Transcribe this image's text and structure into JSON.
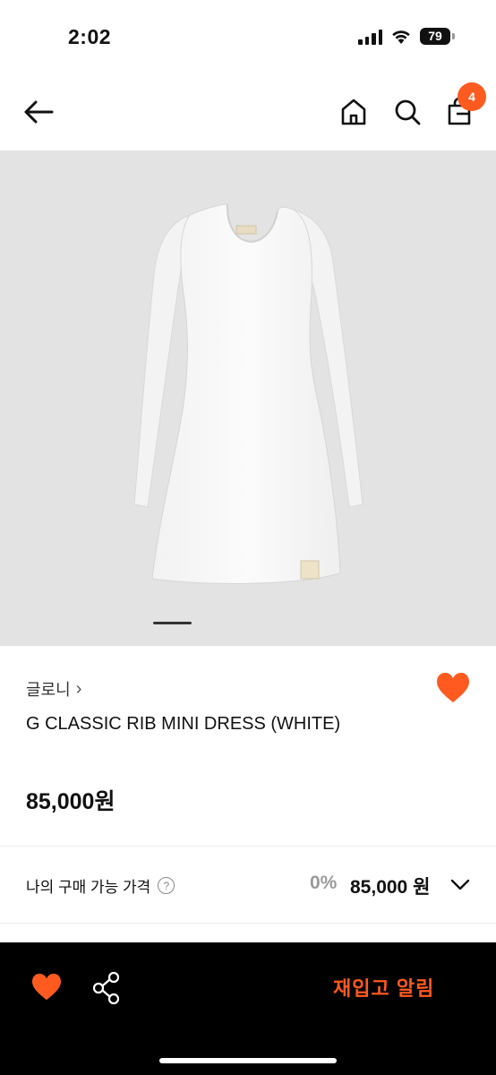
{
  "status_bar": {
    "time": "2:02",
    "battery": "79"
  },
  "header": {
    "cart_count": "4"
  },
  "product": {
    "brand": "글로니",
    "brand_arrow": "›",
    "name": "G CLASSIC RIB MINI DRESS (WHITE)",
    "price": "85,000원",
    "liked": true
  },
  "buy_price": {
    "label": "나의 구매 가능 가격",
    "help": "?",
    "discount": "0%",
    "price": "85,000 원"
  },
  "bottom_bar": {
    "restock_label": "재입고 알림"
  },
  "colors": {
    "accent": "#ff5a1f",
    "image_bg": "#e3e3e3"
  },
  "icons": [
    "back-arrow-icon",
    "home-icon",
    "search-icon",
    "shopping-bag-icon",
    "heart-icon",
    "share-icon",
    "chevron-down-icon"
  ]
}
